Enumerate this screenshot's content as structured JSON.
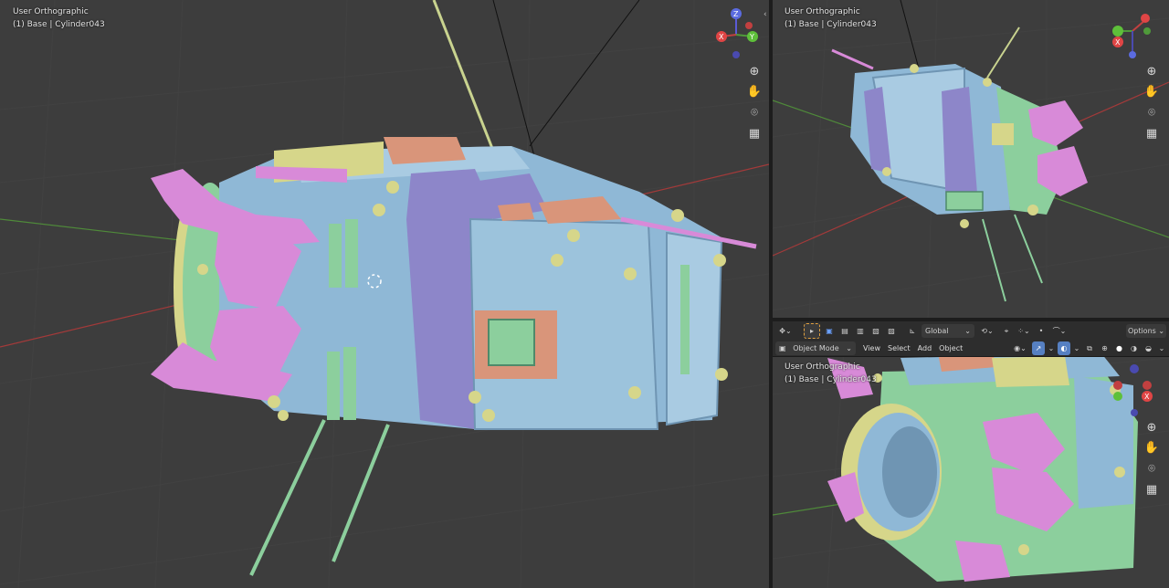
{
  "viewports": [
    {
      "view_name": "User Orthographic",
      "object_info": "(1) Base | Cylinder043"
    },
    {
      "view_name": "User Orthographic",
      "object_info": "(1) Base | Cylinder043"
    },
    {
      "view_name": "User Orthographic",
      "object_info": "(1) Base | Cylinder043"
    }
  ],
  "gizmo": {
    "x": "X",
    "y": "Y",
    "z": "Z"
  },
  "nav_icons": [
    "zoom-icon",
    "hand-pan-icon",
    "camera-icon",
    "grid-ortho-icon"
  ],
  "header": {
    "transform_orientation": "Global",
    "options_label": "Options",
    "mode_label": "Object Mode",
    "menu": {
      "view": "View",
      "select": "Select",
      "add": "Add",
      "object": "Object"
    }
  },
  "colors": {
    "background": "#3d3d3d",
    "blue_panel": "#8fb8d6",
    "purple": "#8d86c9",
    "green": "#8ccf9d",
    "yellow": "#d6d68a",
    "pink": "#d88ad8",
    "salmon": "#d9957a",
    "axis_red": "#a33a3a",
    "axis_green": "#4f8a3a"
  }
}
